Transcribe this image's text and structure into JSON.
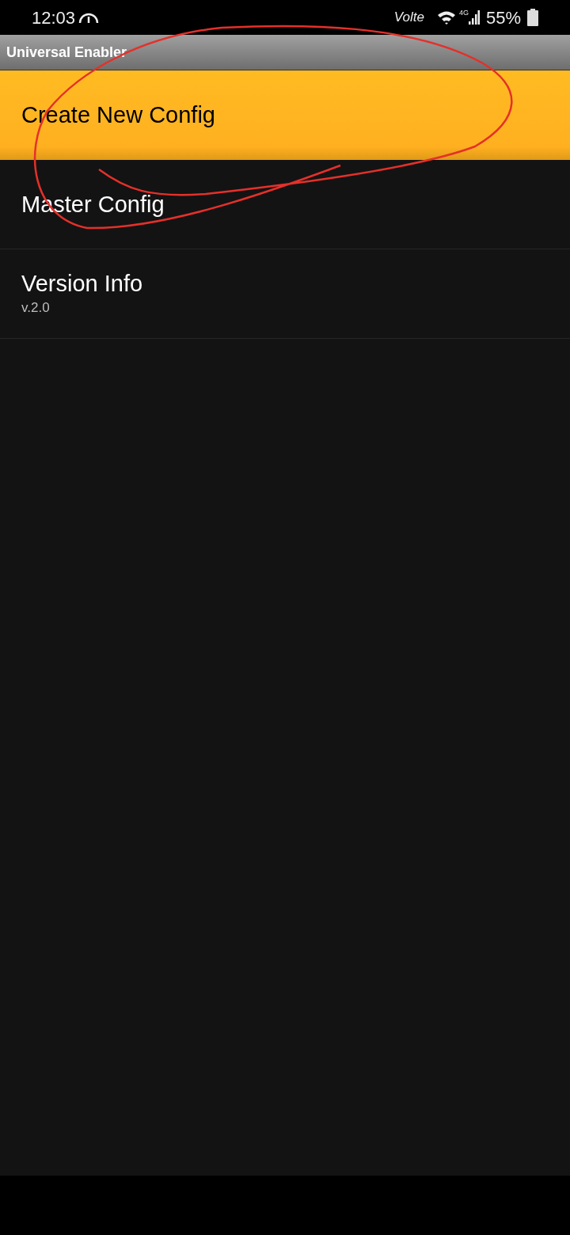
{
  "status_bar": {
    "time": "12:03",
    "volte": "Volte",
    "network": "4G",
    "battery": "55%"
  },
  "title_bar": {
    "title": "Universal Enabler"
  },
  "menu": [
    {
      "title": "Create New Config",
      "selected": true
    },
    {
      "title": "Master Config",
      "selected": false
    },
    {
      "title": "Version Info",
      "subtitle": "v.2.0",
      "selected": false
    }
  ]
}
